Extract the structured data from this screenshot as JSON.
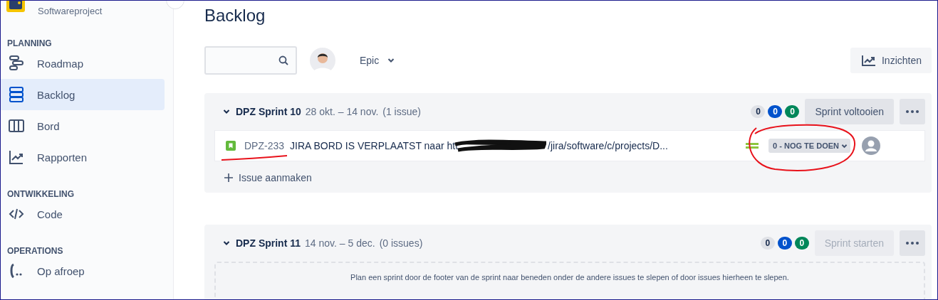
{
  "project": {
    "name": "Softwareproject"
  },
  "sidebar": {
    "sections": [
      {
        "heading": "PLANNING",
        "items": [
          {
            "label": "Roadmap",
            "kind": "roadmap",
            "selected": false
          },
          {
            "label": "Backlog",
            "kind": "backlog",
            "selected": true
          },
          {
            "label": "Bord",
            "kind": "board",
            "selected": false
          },
          {
            "label": "Rapporten",
            "kind": "reports",
            "selected": false
          }
        ]
      },
      {
        "heading": "ONTWIKKELING",
        "items": [
          {
            "label": "Code",
            "kind": "code",
            "selected": false
          }
        ]
      },
      {
        "heading": "OPERATIONS",
        "items": [
          {
            "label": "Op afroep",
            "kind": "oncall",
            "selected": false
          }
        ]
      }
    ]
  },
  "page": {
    "title": "Backlog"
  },
  "toolbar": {
    "epic_filter": "Epic",
    "insights_button": "Inzichten"
  },
  "sprints": [
    {
      "name": "DPZ Sprint 10",
      "dates": "28 okt. – 14 nov.",
      "count": "(1 issue)",
      "badges": [
        {
          "value": "0",
          "color": "#dfe1e6"
        },
        {
          "value": "0",
          "color": "#0052cc"
        },
        {
          "value": "0",
          "color": "#00875a"
        }
      ],
      "action": {
        "label": "Sprint voltooien",
        "disabled": false
      },
      "issues": [
        {
          "key": "DPZ-233",
          "summary_start": "JIRA BORD IS VERPLAATST naar htt",
          "redacted": true,
          "summary_end": "/jira/software/c/projects/D...",
          "status": "0 - NOG TE DOEN",
          "annotated": true
        }
      ],
      "create_label": "Issue aanmaken"
    },
    {
      "name": "DPZ Sprint 11",
      "dates": "14 nov. – 5 dec.",
      "count": "(0 issues)",
      "badges": [
        {
          "value": "0",
          "color": "#dfe1e6"
        },
        {
          "value": "0",
          "color": "#0052cc"
        },
        {
          "value": "0",
          "color": "#00875a"
        }
      ],
      "action": {
        "label": "Sprint starten",
        "disabled": true
      },
      "empty_text": "Plan een sprint door de footer van de sprint naar beneden onder de andere issues te slepen of door issues hierheen te slepen."
    }
  ]
}
